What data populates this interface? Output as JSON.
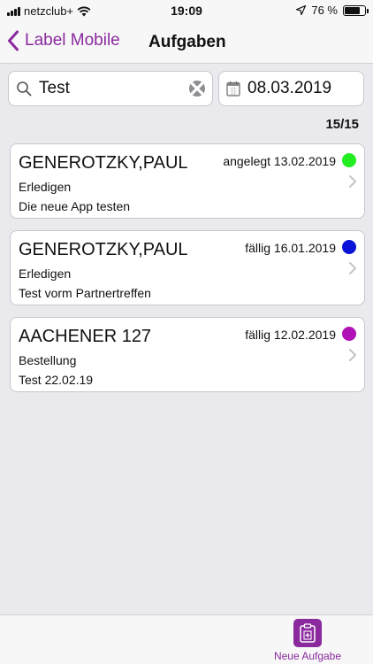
{
  "status_bar": {
    "carrier": "netzclub+",
    "time": "19:09",
    "battery_percent": "76 %",
    "battery_level": 0.76
  },
  "nav": {
    "back_label": "Label Mobile",
    "title": "Aufgaben"
  },
  "search": {
    "value": "Test",
    "placeholder": ""
  },
  "date_filter": {
    "value": "08.03.2019"
  },
  "result_count": "15/15",
  "tasks": [
    {
      "name": "GENEROTZKY,PAUL",
      "date": "angelegt 13.02.2019",
      "type": "Erledigen",
      "description": "Die neue App testen",
      "color": "#22ee22"
    },
    {
      "name": "GENEROTZKY,PAUL",
      "date": "fällig 16.01.2019",
      "type": "Erledigen",
      "description": "Test vorm Partnertreffen",
      "color": "#0a14d8"
    },
    {
      "name": "AACHENER 127",
      "date": "fällig 12.02.2019",
      "type": "Bestellung",
      "description": "Test 22.02.19",
      "color": "#b012b8"
    }
  ],
  "tab_bar": {
    "new_task_label": "Neue Aufgabe"
  },
  "colors": {
    "accent": "#8a2a9e",
    "background": "#eaeaee"
  }
}
